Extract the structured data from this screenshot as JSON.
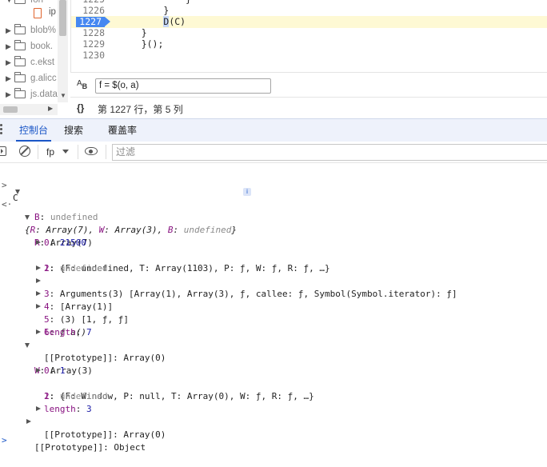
{
  "tree": {
    "top_label": "fon",
    "file_label": "ip",
    "folders": [
      "blob%",
      "book.",
      "c.ekst",
      "g.alicc",
      "js.data"
    ]
  },
  "editor": {
    "lines": [
      {
        "num": "1225",
        "code": "            }"
      },
      {
        "num": "1226",
        "code": "        }"
      },
      {
        "num": "1227",
        "code_pre": "        ",
        "code_sel": "D",
        "code_post": "(C)",
        "current": true
      },
      {
        "num": "1228",
        "code": "    }"
      },
      {
        "num": "1229",
        "code": "    }();"
      },
      {
        "num": "1230",
        "code": ""
      }
    ]
  },
  "find": {
    "icon_label": "A",
    "icon_sub": "B",
    "value": "f = $(o, a)"
  },
  "status": {
    "braces": "{}",
    "position_text": "第 1227 行，第 5 列"
  },
  "drawer": {
    "tabs": [
      {
        "label": "控制台",
        "active": true
      },
      {
        "label": "搜索",
        "active": false
      },
      {
        "label": "覆盖率",
        "active": false
      }
    ]
  },
  "toolbar": {
    "context": "fp",
    "filter_placeholder": "过滤"
  },
  "console": {
    "input_prompt": ">",
    "input_expr": "C",
    "result_prompt": "<·",
    "result_summary_open": "{",
    "result_R_key": "R",
    "result_R_val": "Array(7)",
    "result_W_key": "W",
    "result_W_val": "Array(3)",
    "result_B_key": "B",
    "result_B_val": "undefined",
    "result_summary_close": "}",
    "info_badge": "i",
    "rows": {
      "b_key": "B",
      "b_val": "undefined",
      "r_key": "R",
      "r_val": "Array(7)",
      "r0_key": "0",
      "r0_val": "21500",
      "r1_key": "1",
      "r1_val": "{F: undefined, T: Array(1103), P: ƒ, W: ƒ, R: ƒ, …}",
      "r2_key": "2",
      "r2_val": "undefined",
      "r3_key": "3",
      "r3_val": "Arguments(3) [Array(1), Array(3), ƒ, callee: ƒ, Symbol(Symbol.iterator): ƒ]",
      "r4_key": "4",
      "r4_val": "[Array(1)]",
      "r5_key": "5",
      "r5_val": "(3) [1, ƒ, ƒ]",
      "r6_key": "6",
      "r6_val": "ƒ a()",
      "r_length_key": "length",
      "r_length_val": "7",
      "r_proto_key": "[[Prototype]]",
      "r_proto_val": "Array(0)",
      "w_key": "W",
      "w_val": "Array(3)",
      "w0_key": "0",
      "w0_val": "1",
      "w1_key": "1",
      "w1_val": "{F: Window, P: null, T: Array(0), W: ƒ, R: ƒ, …}",
      "w2_key": "2",
      "w2_val": "undefined",
      "w_length_key": "length",
      "w_length_val": "3",
      "w_proto_key": "[[Prototype]]",
      "w_proto_val": "Array(0)",
      "proto_key": "[[Prototype]]",
      "proto_val": "Object"
    },
    "bottom_prompt": ">"
  },
  "colors": {
    "accent": "#1a56c7",
    "breakpoint": "#4688f1",
    "current_line": "#fef9d4",
    "key": "#881280",
    "number": "#1a1aa6"
  }
}
